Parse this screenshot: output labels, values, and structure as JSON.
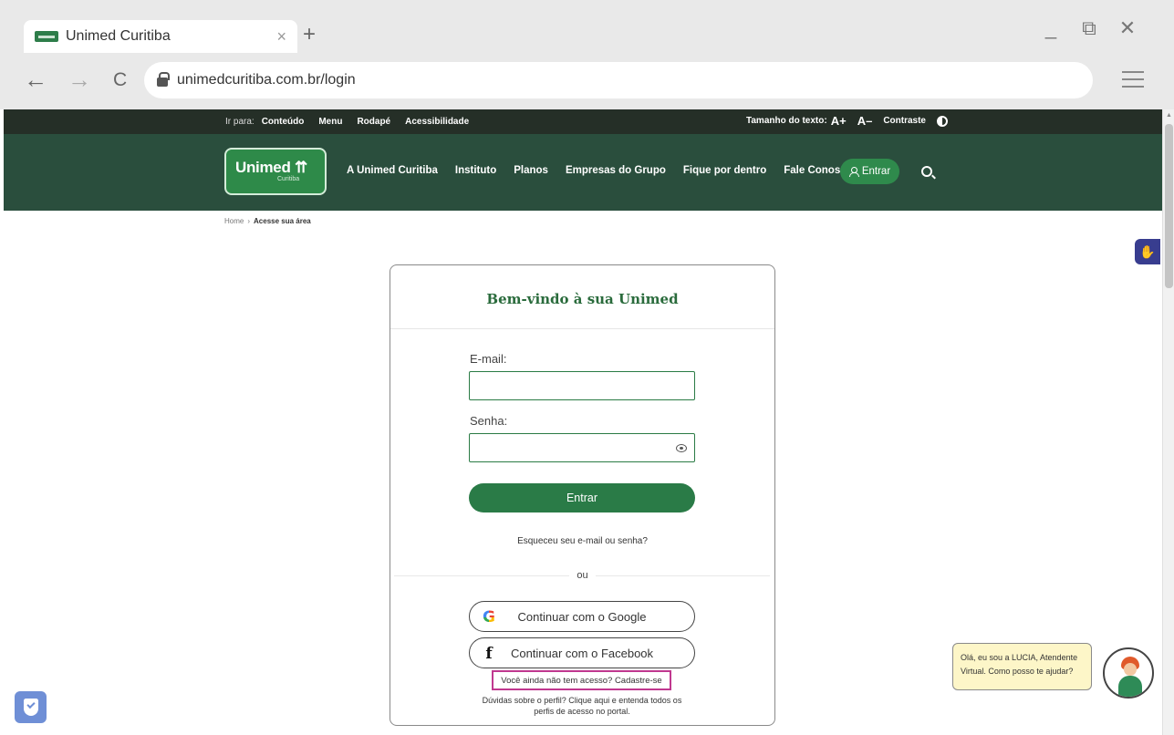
{
  "browser": {
    "tab_title": "Unimed Curitiba",
    "tab_close": "×",
    "new_tab": "+",
    "url": "unimedcuritiba.com.br/login",
    "back": "←",
    "forward": "→",
    "reload": "C",
    "minimize": "_",
    "restore": "⧉",
    "close": "✕"
  },
  "utility": {
    "goto_label": "Ir para:",
    "links": [
      "Conteúdo",
      "Menu",
      "Rodapé",
      "Acessibilidade"
    ],
    "text_size_label": "Tamanho do texto:",
    "increase": "A+",
    "decrease": "A–",
    "contrast": "Contraste"
  },
  "nav": {
    "logo_word": "Unimed",
    "logo_symbol": "⇈",
    "logo_sub": "Curitiba",
    "links": [
      "A Unimed Curitiba",
      "Instituto",
      "Planos",
      "Empresas do Grupo",
      "Fique por dentro",
      "Fale Conosco"
    ],
    "enter": "Entrar"
  },
  "breadcrumb": {
    "home": "Home",
    "separator": "›",
    "current": "Acesse sua área"
  },
  "login": {
    "title": "Bem-vindo à sua Unimed",
    "email_label": "E-mail:",
    "email_value": "",
    "password_label": "Senha:",
    "password_value": "",
    "submit": "Entrar",
    "forgot": "Esqueceu seu e-mail ou senha?",
    "or": "ou",
    "google": "Continuar com o Google",
    "google_icon": "G",
    "facebook": "Continuar com o Facebook",
    "facebook_icon": "f",
    "signup": "Você ainda não tem acesso? Cadastre-se",
    "help_line1": "Dúvidas sobre o perfil? Clique aqui e entenda todos os",
    "help_line2": "perfis de acesso no portal."
  },
  "chat": {
    "message": "Olá, eu sou a LUCIA, Atendente Virtual. Como posso te ajudar?"
  },
  "colors": {
    "brand_dark": "#2a4e3d",
    "brand_green": "#2a7b47",
    "utility_bar": "#252f27",
    "highlight": "#c0388f"
  }
}
